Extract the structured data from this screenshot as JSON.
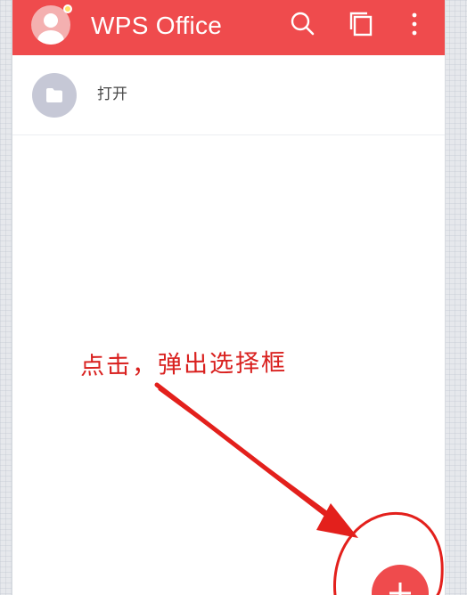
{
  "app_bar": {
    "title": "WPS Office",
    "background_color": "#ef4b4d",
    "avatar_icon": "user-avatar-icon",
    "notification_dot_color": "#ffe16b",
    "actions": [
      {
        "name": "search",
        "icon": "search-icon"
      },
      {
        "name": "multi-window",
        "icon": "copy-icon"
      },
      {
        "name": "more",
        "icon": "more-vertical-icon"
      }
    ]
  },
  "list": {
    "items": [
      {
        "label": "打开",
        "icon": "folder-icon"
      }
    ]
  },
  "annotation": {
    "text": "点击，弹出选择框",
    "color": "#d9211f",
    "icon": "arrow-icon",
    "highlight": "circle-highlight"
  },
  "fab": {
    "color": "#ef4b4d",
    "icon": "add-icon"
  }
}
